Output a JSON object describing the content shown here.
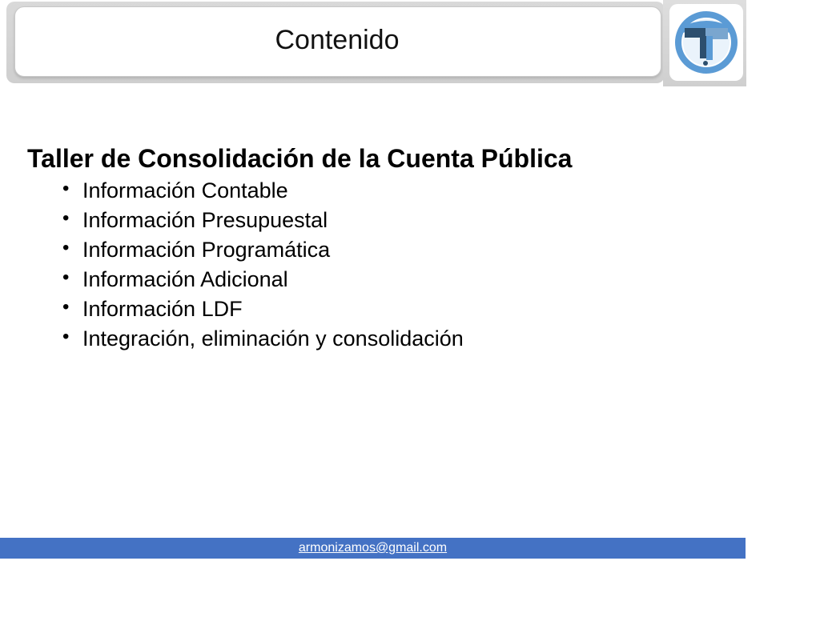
{
  "slide": {
    "title": "Contenido",
    "heading": "Taller de Consolidación de la Cuenta Pública",
    "items": [
      "Información Contable",
      "Información Presupuestal",
      "Información Programática",
      "Información Adicional",
      "Información LDF",
      "Integración, eliminación y consolidación"
    ],
    "bullet_glyph": "•"
  },
  "footer": {
    "email": "armonizamos@gmail.com"
  },
  "logo": {
    "icon": "t-emblem-logo"
  },
  "colors": {
    "footer_bar": "#4472c4",
    "logo_ring": "#5b9bd5",
    "logo_dark": "#2c4f6e"
  }
}
